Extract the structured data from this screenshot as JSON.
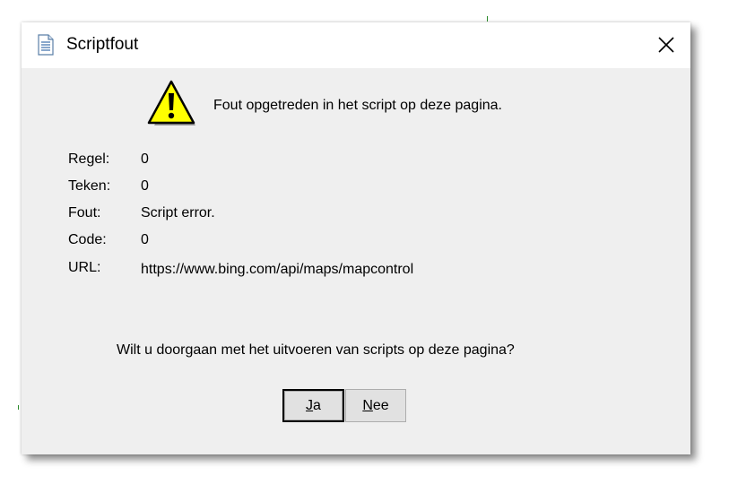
{
  "dialog": {
    "title": "Scriptfout",
    "message": "Fout opgetreden in het script op deze pagina.",
    "details": [
      {
        "label": "Regel:",
        "value": "0"
      },
      {
        "label": "Teken:",
        "value": "0"
      },
      {
        "label": "Fout:",
        "value": "Script error."
      },
      {
        "label": "Code:",
        "value": "0"
      },
      {
        "label": "URL:",
        "value": "https://www.bing.com/api/maps/mapcontrol"
      }
    ],
    "question": "Wilt u doorgaan met het uitvoeren van scripts op deze pagina?",
    "buttons": {
      "yes": {
        "mnemonic": "J",
        "rest": "a"
      },
      "no": {
        "mnemonic": "N",
        "rest": "ee"
      }
    }
  },
  "icons": {
    "title": "document-icon",
    "close": "close-icon",
    "alert": "warning-icon"
  },
  "colors": {
    "dialog_background": "#efefef",
    "titlebar_background": "#ffffff",
    "button_background": "#e1e1e1",
    "warning_yellow": "#ffff00"
  }
}
